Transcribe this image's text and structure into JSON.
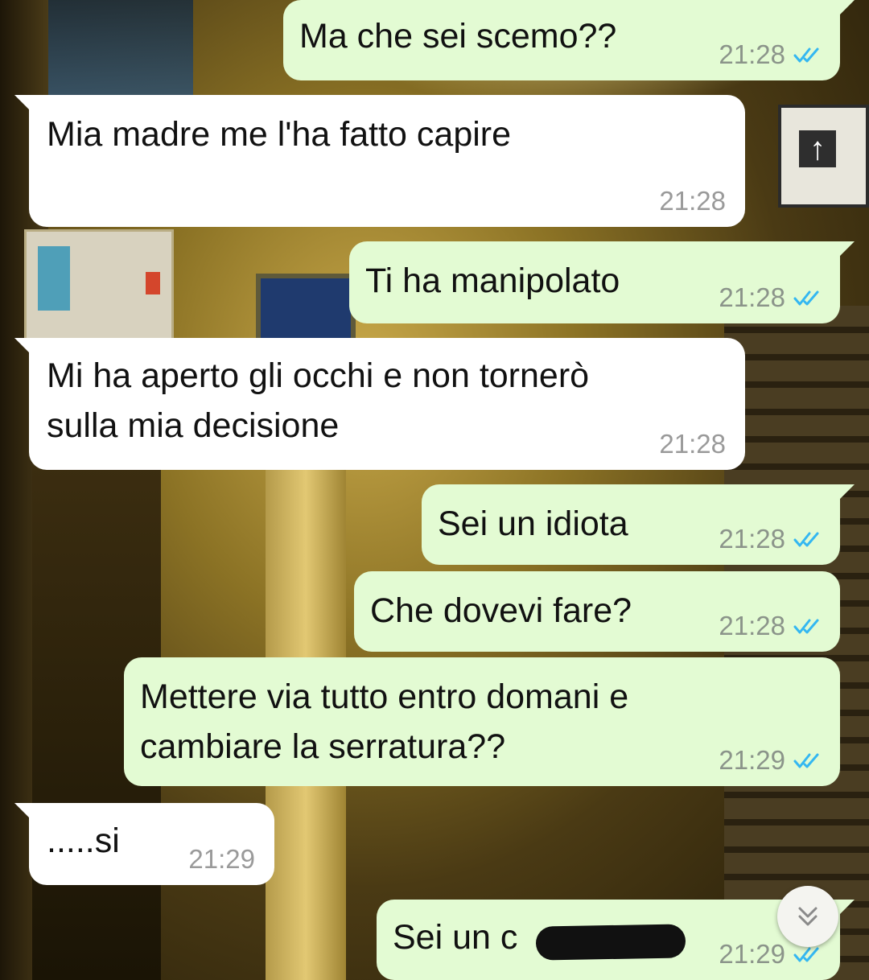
{
  "colors": {
    "outgoing_bubble": "#e3fbd3",
    "incoming_bubble": "#ffffff",
    "read_ticks": "#34b7f1",
    "timestamp": "#8b948a"
  },
  "messages": [
    {
      "direction": "out",
      "text": "Ma che sei scemo??",
      "time": "21:28",
      "status_icon": "double-check-read-icon"
    },
    {
      "direction": "in",
      "text": "Mia madre me l'ha fatto capire",
      "time": "21:28"
    },
    {
      "direction": "out",
      "text": "Ti ha manipolato",
      "time": "21:28",
      "status_icon": "double-check-read-icon"
    },
    {
      "direction": "in",
      "text": "Mi ha aperto gli occhi e non tornerò\nsulla mia decisione",
      "time": "21:28"
    },
    {
      "direction": "out",
      "text": "Sei un idiota",
      "time": "21:28",
      "status_icon": "double-check-read-icon"
    },
    {
      "direction": "out",
      "text": "Che dovevi fare?",
      "time": "21:28",
      "status_icon": "double-check-read-icon"
    },
    {
      "direction": "out",
      "text": "Mettere via tutto entro domani e\ncambiare la serratura??",
      "time": "21:29",
      "status_icon": "double-check-read-icon"
    },
    {
      "direction": "in",
      "text": ".....si",
      "time": "21:29"
    },
    {
      "direction": "out",
      "text": "Sei un c",
      "time": "21:29",
      "status_icon": "double-check-read-icon",
      "partially_censored": true
    }
  ],
  "scroll_button": {
    "icon": "double-chevron-down-icon"
  }
}
